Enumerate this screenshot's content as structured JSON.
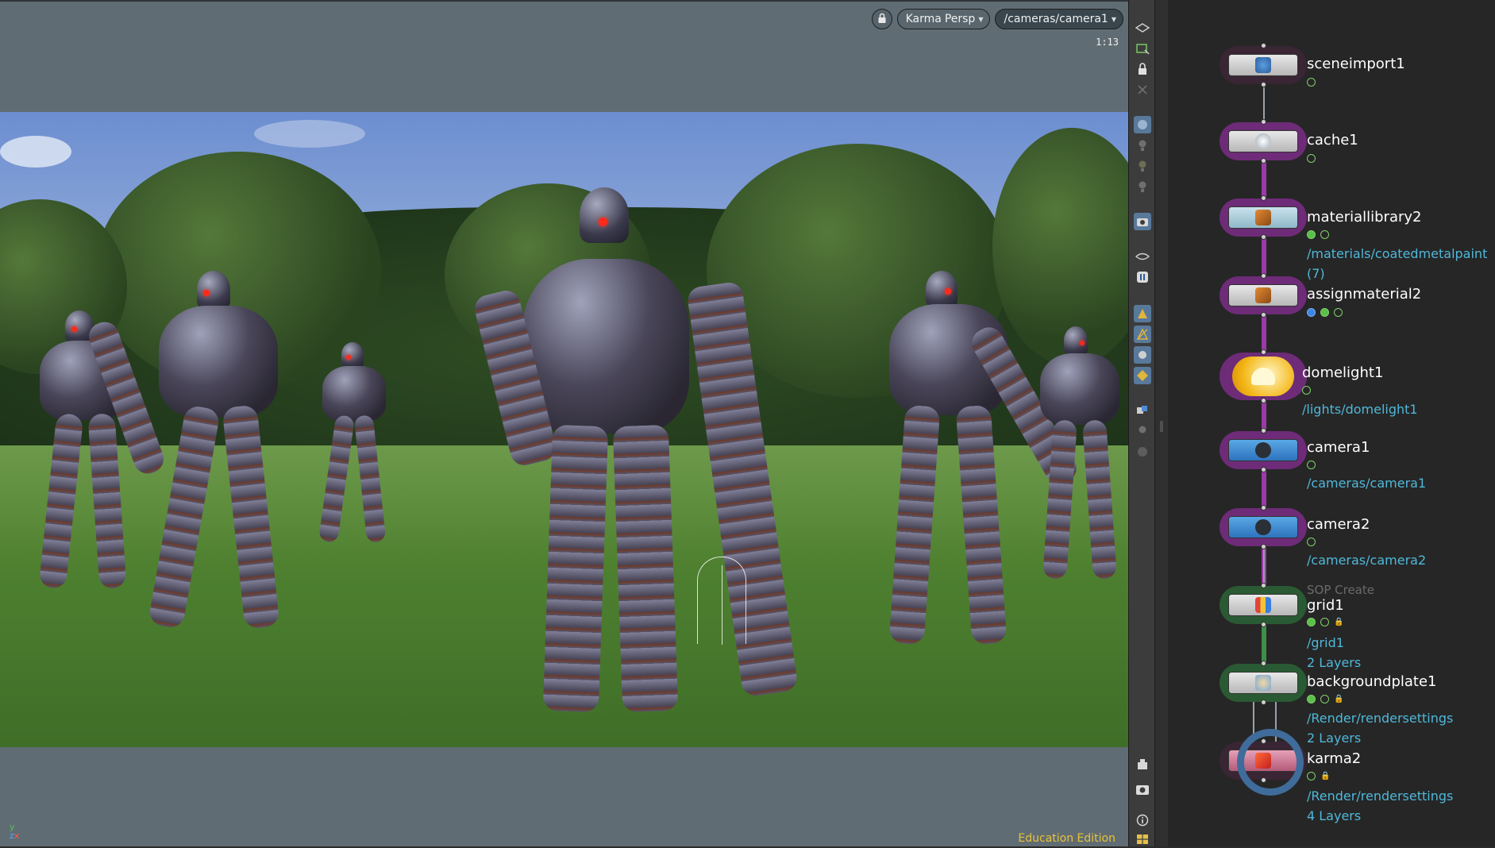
{
  "viewport": {
    "renderer_label": "Karma",
    "view_label": "Persp",
    "camera_path": "/cameras/camera1",
    "zoom_readout": "1:13",
    "edition_label": "Education Edition",
    "axis": {
      "y": "y",
      "z": "z",
      "x": "x"
    }
  },
  "shelf": {
    "tools": [
      "display-options-icon",
      "snapshot-icon",
      "lock-icon",
      "close-icon",
      "sphere-icon",
      "light-icon",
      "light-bulb-icon",
      "light-bulb-2-icon",
      "camera-view-icon",
      "flipbook-icon",
      "pause-icon",
      "shading-icon",
      "wireframe-icon",
      "material-icon",
      "geometry-icon",
      "link-icon",
      "circle-icon",
      "render-region-icon",
      "eye-icon",
      "info-icon",
      "layout-icon"
    ]
  },
  "network": {
    "nodes": [
      {
        "name": "sceneimport1",
        "details": [],
        "flags": [
          "blue"
        ],
        "color": "#3a2534"
      },
      {
        "name": "cache1",
        "details": [],
        "flags": [
          "green"
        ],
        "color": "#6e2b78"
      },
      {
        "name": "materiallibrary2",
        "details": [
          "/materials/coatedmetalpaint",
          "(7)"
        ],
        "flags": [
          "on",
          "green"
        ],
        "color": "#6e2b78"
      },
      {
        "name": "assignmaterial2",
        "details": [],
        "flags": [
          "blue",
          "on",
          "green"
        ],
        "color": "#6e2b78"
      },
      {
        "name": "domelight1",
        "details": [
          "/lights/domelight1"
        ],
        "flags": [
          "green"
        ],
        "color": "#6e2b78"
      },
      {
        "name": "camera1",
        "details": [
          "/cameras/camera1"
        ],
        "flags": [
          "green"
        ],
        "color": "#6e2b78"
      },
      {
        "name": "camera2",
        "details": [
          "/cameras/camera2"
        ],
        "flags": [
          "green"
        ],
        "color": "#6e2b78"
      },
      {
        "name": "grid1",
        "category": "SOP Create",
        "details": [
          "/grid1",
          "2 Layers"
        ],
        "flags": [
          "on",
          "green",
          "lock"
        ],
        "color": "#2a5a33"
      },
      {
        "name": "backgroundplate1",
        "details": [
          "/Render/rendersettings",
          "2 Layers"
        ],
        "flags": [
          "on",
          "green",
          "lock"
        ],
        "color": "#2a5a33"
      },
      {
        "name": "karma2",
        "details": [
          "/Render/rendersettings",
          "4 Layers"
        ],
        "flags": [
          "green",
          "lock"
        ],
        "color": "#3a2534"
      }
    ]
  }
}
